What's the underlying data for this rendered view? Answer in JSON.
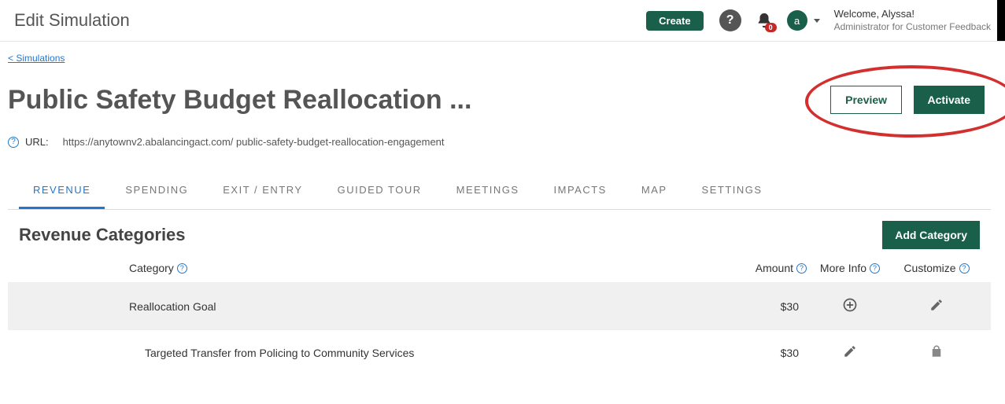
{
  "header": {
    "title": "Edit Simulation",
    "create_label": "Create",
    "notification_count": "0",
    "avatar_initial": "a",
    "welcome_line1": "Welcome, Alyssa!",
    "welcome_line2": "Administrator for Customer Feedback"
  },
  "breadcrumb": {
    "back_label": "< Simulations"
  },
  "page": {
    "title": "Public Safety Budget Reallocation ...",
    "preview_label": "Preview",
    "activate_label": "Activate",
    "url_label": "URL:",
    "url_value": "https://anytownv2.abalancingact.com/ public-safety-budget-reallocation-engagement"
  },
  "tabs": [
    {
      "label": "REVENUE",
      "active": true
    },
    {
      "label": "SPENDING",
      "active": false
    },
    {
      "label": "EXIT / ENTRY",
      "active": false
    },
    {
      "label": "GUIDED TOUR",
      "active": false
    },
    {
      "label": "MEETINGS",
      "active": false
    },
    {
      "label": "IMPACTS",
      "active": false
    },
    {
      "label": "MAP",
      "active": false
    },
    {
      "label": "SETTINGS",
      "active": false
    }
  ],
  "section": {
    "title": "Revenue Categories",
    "add_label": "Add Category",
    "columns": {
      "category": "Category",
      "amount": "Amount",
      "more_info": "More Info",
      "customize": "Customize"
    }
  },
  "rows": [
    {
      "type": "category",
      "name": "Reallocation Goal",
      "amount": "$30",
      "moreIcon": "plus-circle",
      "customizeIcon": "pencil"
    },
    {
      "type": "item",
      "name": "Targeted Transfer from Policing to Community Services",
      "amount": "$30",
      "moreIcon": "pencil",
      "customizeIcon": "lock"
    }
  ]
}
